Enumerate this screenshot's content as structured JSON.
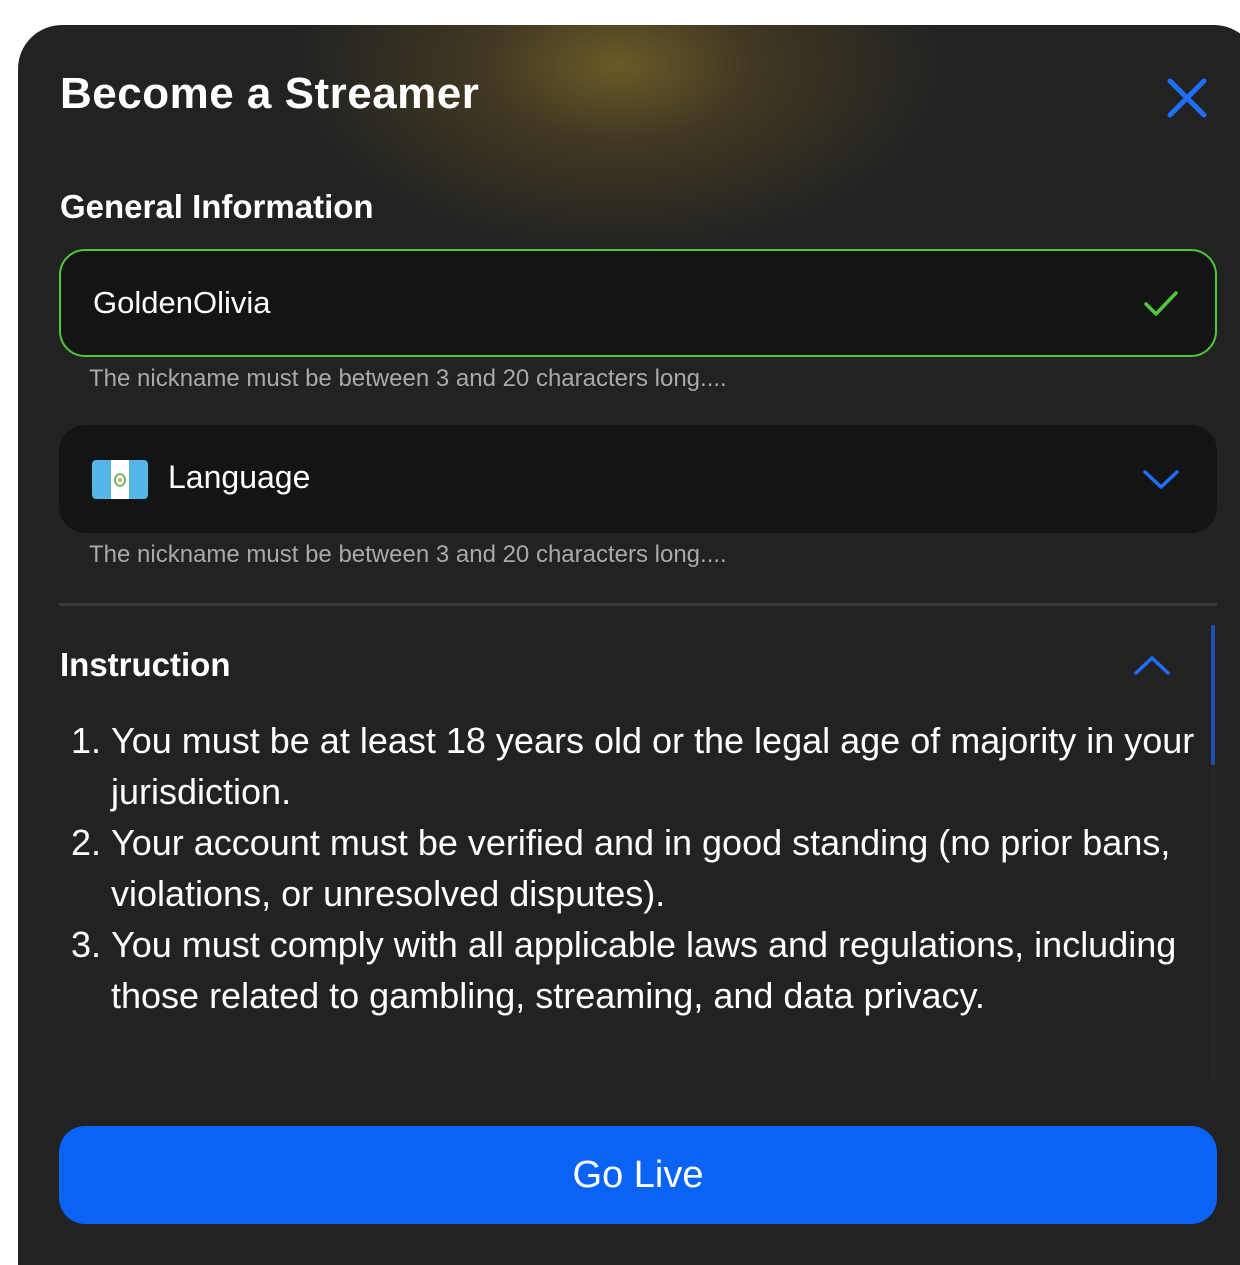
{
  "modal": {
    "title": "Become a Streamer"
  },
  "general": {
    "heading": "General Information",
    "nickname": {
      "value": "GoldenOlivia",
      "hint": "The nickname must be between 3 and 20 characters long...."
    },
    "language": {
      "label": "Language",
      "flag": "guatemala-flag-icon",
      "hint": "The nickname must be between 3 and 20 characters long...."
    }
  },
  "instruction": {
    "heading": "Instruction",
    "items": [
      "You must be at least 18 years old or the legal age of majority in your jurisdiction.",
      "Your account must be verified and in good standing (no prior bans, violations, or unresolved disputes).",
      "You must comply with all applicable laws and regulations, including those related to gambling, streaming, and data privacy."
    ]
  },
  "actions": {
    "go_live_label": "Go Live"
  },
  "colors": {
    "accent": "#0b63f5",
    "success": "#4fc83a",
    "background": "#222222"
  }
}
